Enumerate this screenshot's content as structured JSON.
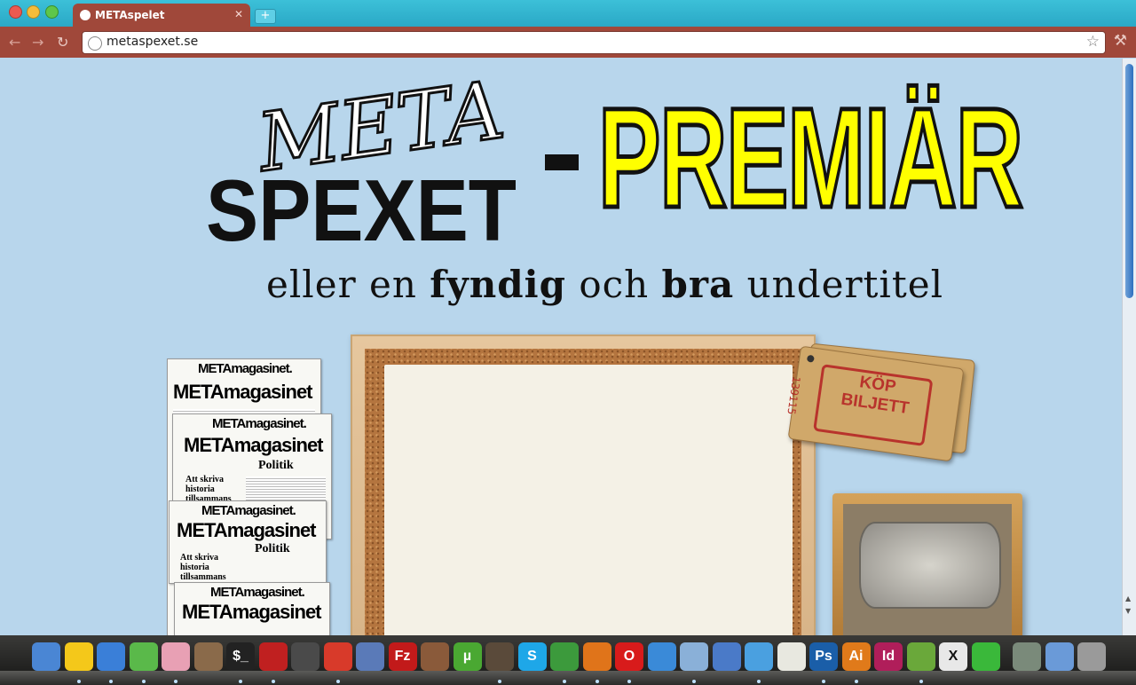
{
  "browser": {
    "tab_title": "METAspelet",
    "tab_close": "✕",
    "new_tab": "+",
    "back": "←",
    "forward": "→",
    "reload": "↻",
    "url": "metaspexet.se",
    "bookmark_star": "☆",
    "wrench": "🔧"
  },
  "page": {
    "logo_top": "META",
    "logo_bottom": "SPEXET",
    "headline": "PREMIÄR",
    "subtitle_parts": [
      "eller en ",
      "fyndig",
      " och ",
      "bra",
      " undertitel"
    ]
  },
  "magazines": {
    "masthead_large": "METAmagasinet",
    "masthead_small": "METAmagasinet.",
    "section": "Politik",
    "headline": "Att skriva historia tillsammans"
  },
  "ticket": {
    "label_line1": "KÖP",
    "label_line2": "BILJETT",
    "serial": "139115"
  },
  "dock": {
    "icons": [
      {
        "name": "finder-icon",
        "label": "",
        "color": "#4a86d4"
      },
      {
        "name": "adium-duck-icon",
        "label": "",
        "color": "#f4c81a"
      },
      {
        "name": "itunes-icon",
        "label": "",
        "color": "#3a7fd8"
      },
      {
        "name": "spotify-icon",
        "label": "",
        "color": "#5ab94a"
      },
      {
        "name": "pie-app-icon",
        "label": "",
        "color": "#e8a0b4"
      },
      {
        "name": "iphoto-icon",
        "label": "",
        "color": "#8a6a4a"
      },
      {
        "name": "terminal-icon",
        "label": "$_",
        "color": "#222222"
      },
      {
        "name": "photo-booth-icon",
        "label": "",
        "color": "#c02020"
      },
      {
        "name": "steam-icon",
        "label": "",
        "color": "#4a4a4a"
      },
      {
        "name": "mail-icon",
        "label": "",
        "color": "#d83a2a"
      },
      {
        "name": "preview-icon",
        "label": "",
        "color": "#5a7ab8"
      },
      {
        "name": "filezilla-icon",
        "label": "Fz",
        "color": "#c21a1a"
      },
      {
        "name": "basketball-icon",
        "label": "",
        "color": "#8a5a3a"
      },
      {
        "name": "utorrent-icon",
        "label": "µ",
        "color": "#4aa832"
      },
      {
        "name": "coffee-icon",
        "label": "",
        "color": "#5a4a3a"
      },
      {
        "name": "skype-icon",
        "label": "S",
        "color": "#1ea7e8"
      },
      {
        "name": "chrome-icon",
        "label": "",
        "color": "#3c9a3c"
      },
      {
        "name": "firefox-icon",
        "label": "",
        "color": "#e0741a"
      },
      {
        "name": "opera-icon",
        "label": "O",
        "color": "#d81b1b"
      },
      {
        "name": "safari-icon",
        "label": "",
        "color": "#3a8ad8"
      },
      {
        "name": "virtualbox-icon",
        "label": "",
        "color": "#8ab0d8"
      },
      {
        "name": "xcode-icon",
        "label": "",
        "color": "#4a7ac8"
      },
      {
        "name": "fluid-icon",
        "label": "",
        "color": "#4aa0e0"
      },
      {
        "name": "textedit-icon",
        "label": "",
        "color": "#e8e8e0"
      },
      {
        "name": "photoshop-icon",
        "label": "Ps",
        "color": "#1a5ea8"
      },
      {
        "name": "illustrator-icon",
        "label": "Ai",
        "color": "#e07a1a"
      },
      {
        "name": "indesign-icon",
        "label": "Id",
        "color": "#b01e5a"
      },
      {
        "name": "evernote-icon",
        "label": "",
        "color": "#6aa83a"
      },
      {
        "name": "x11-icon",
        "label": "X",
        "color": "#e8e8e8"
      },
      {
        "name": "xquartz-icon",
        "label": "",
        "color": "#3ab83a"
      },
      {
        "name": "downloads-stack-icon",
        "label": "",
        "color": "#7a8a7a"
      },
      {
        "name": "network-folder-icon",
        "label": "",
        "color": "#6a9ad8"
      },
      {
        "name": "trash-icon",
        "label": "",
        "color": "#9a9a9a"
      }
    ]
  }
}
